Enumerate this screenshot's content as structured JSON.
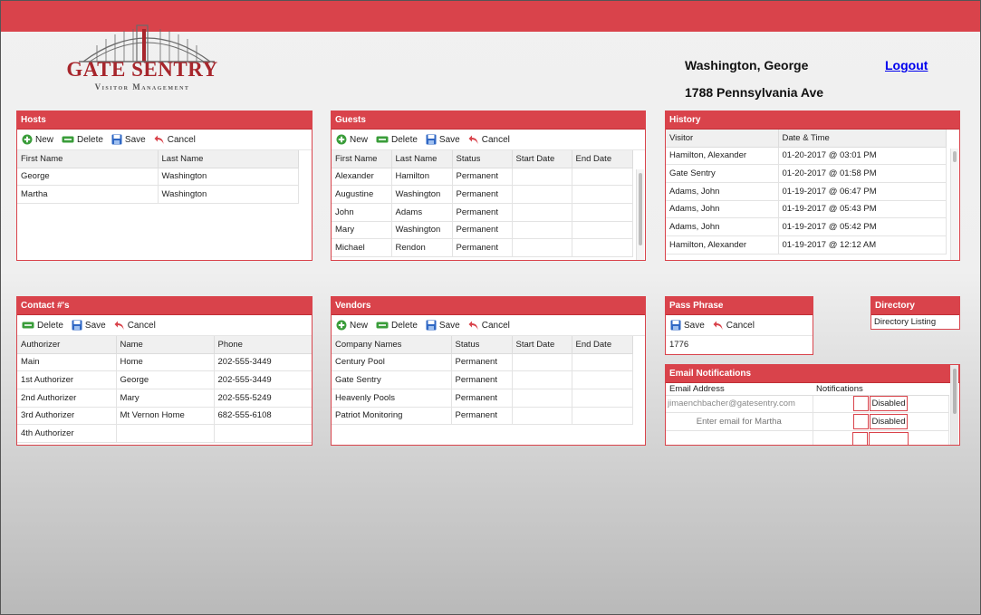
{
  "brand": {
    "name": "GATE SENTRY",
    "tagline": "Visitor Management",
    "accent_color": "#d9434b",
    "logo_icon": "gate-icon"
  },
  "user": {
    "name": "Washington, George",
    "address": "1788 Pennsylvania Ave",
    "logout_label": "Logout"
  },
  "toolbar_labels": {
    "new": "New",
    "delete": "Delete",
    "save": "Save",
    "cancel": "Cancel"
  },
  "hosts": {
    "title": "Hosts",
    "columns": [
      "First Name",
      "Last Name"
    ],
    "rows": [
      [
        "George",
        "Washington"
      ],
      [
        "Martha",
        "Washington"
      ]
    ]
  },
  "guests": {
    "title": "Guests",
    "columns": [
      "First Name",
      "Last Name",
      "Status",
      "Start Date",
      "End Date"
    ],
    "rows": [
      [
        "Alexander",
        "Hamilton",
        "Permanent",
        "",
        ""
      ],
      [
        "Augustine",
        "Washington",
        "Permanent",
        "",
        ""
      ],
      [
        "John",
        "Adams",
        "Permanent",
        "",
        ""
      ],
      [
        "Mary",
        "Washington",
        "Permanent",
        "",
        ""
      ],
      [
        "Michael",
        "Rendon",
        "Permanent",
        "",
        ""
      ]
    ]
  },
  "history": {
    "title": "History",
    "columns": [
      "Visitor",
      "Date & Time"
    ],
    "rows": [
      [
        "Hamilton, Alexander",
        "01-20-2017 @ 03:01 PM"
      ],
      [
        "Gate Sentry",
        "01-20-2017 @ 01:58 PM"
      ],
      [
        "Adams, John",
        "01-19-2017 @ 06:47 PM"
      ],
      [
        "Adams, John",
        "01-19-2017 @ 05:43 PM"
      ],
      [
        "Adams, John",
        "01-19-2017 @ 05:42 PM"
      ],
      [
        "Hamilton, Alexander",
        "01-19-2017 @ 12:12 AM"
      ]
    ]
  },
  "contacts": {
    "title": "Contact #'s",
    "columns": [
      "Authorizer",
      "Name",
      "Phone"
    ],
    "rows": [
      [
        "Main",
        "Home",
        "202-555-3449"
      ],
      [
        "1st Authorizer",
        "George",
        "202-555-3449"
      ],
      [
        "2nd Authorizer",
        "Mary",
        "202-555-5249"
      ],
      [
        "3rd Authorizer",
        "Mt Vernon Home",
        "682-555-6108"
      ],
      [
        "4th Authorizer",
        "",
        ""
      ]
    ]
  },
  "vendors": {
    "title": "Vendors",
    "columns": [
      "Company Names",
      "Status",
      "Start Date",
      "End Date"
    ],
    "rows": [
      [
        "Century Pool",
        "Permanent",
        "",
        ""
      ],
      [
        "Gate Sentry",
        "Permanent",
        "",
        ""
      ],
      [
        "Heavenly Pools",
        "Permanent",
        "",
        ""
      ],
      [
        "Patriot Monitoring",
        "Permanent",
        "",
        ""
      ]
    ]
  },
  "pass_phrase": {
    "title": "Pass Phrase",
    "value": "1776"
  },
  "directory": {
    "title": "Directory",
    "link_label": "Directory Listing"
  },
  "email_notifications": {
    "title": "Email Notifications",
    "columns": [
      "Email Address",
      "Notifications"
    ],
    "rows": [
      {
        "value": "jimaenchbacher@gatesentry.com",
        "placeholder": "",
        "status": "Disabled"
      },
      {
        "value": "",
        "placeholder": "Enter email for Martha",
        "status": "Disabled"
      },
      {
        "value": "",
        "placeholder": "",
        "status": ""
      }
    ]
  },
  "icons": {
    "new": "plus-circle-icon",
    "delete": "minus-icon",
    "save": "floppy-disk-icon",
    "cancel": "undo-arrow-icon"
  }
}
